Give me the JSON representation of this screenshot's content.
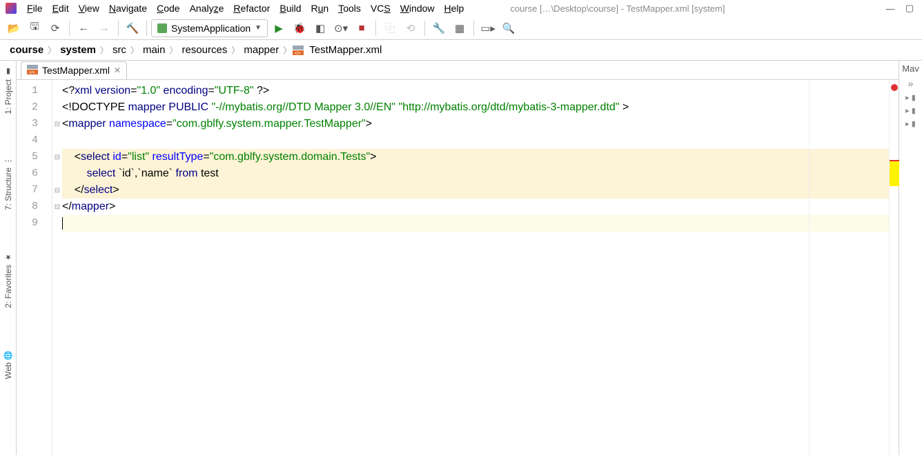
{
  "window": {
    "title": "course […\\Desktop\\course] - TestMapper.xml [system]"
  },
  "menu": {
    "file": "File",
    "edit": "Edit",
    "view": "View",
    "navigate": "Navigate",
    "code": "Code",
    "analyze": "Analyze",
    "refactor": "Refactor",
    "build": "Build",
    "run": "Run",
    "tools": "Tools",
    "vcs": "VCS",
    "window": "Window",
    "help": "Help"
  },
  "runconfig": {
    "label": "SystemApplication"
  },
  "breadcrumb": {
    "items": [
      "course",
      "system",
      "src",
      "main",
      "resources",
      "mapper",
      "TestMapper.xml"
    ]
  },
  "left_rail": {
    "project": "1: Project",
    "structure": "7: Structure",
    "favorites": "2: Favorites",
    "web": "Web"
  },
  "right_rail": {
    "maven": "Mav"
  },
  "tab": {
    "label": "TestMapper.xml"
  },
  "gutter": {
    "numbers": [
      "1",
      "2",
      "3",
      "4",
      "5",
      "6",
      "7",
      "8",
      "9"
    ]
  },
  "code": {
    "l1": {
      "a": "<?",
      "b": "xml version",
      "c": "=",
      "d": "\"1.0\"",
      "e": " encoding",
      "f": "=",
      "g": "\"UTF-8\"",
      "h": " ?>"
    },
    "l2": {
      "a": "<!DOCTYPE ",
      "b": "mapper ",
      "c": "PUBLIC ",
      "d": "\"-//mybatis.org//DTD Mapper 3.0//EN\" \"http://mybatis.org/dtd/mybatis-3-mapper.dtd\"",
      "e": " >"
    },
    "l3": {
      "a": "<",
      "b": "mapper ",
      "c": "namespace",
      "d": "=",
      "e": "\"com.gblfy.system.mapper.TestMapper\"",
      "f": ">"
    },
    "l4": "",
    "l5": {
      "pad": "    ",
      "a": "<",
      "b": "select ",
      "c": "id",
      "d": "=",
      "e": "\"list\"",
      "f": " resultType",
      "g": "=",
      "h": "\"com.gblfy.system.domain.Tests\"",
      "i": ">"
    },
    "l6": {
      "pad": "        ",
      "a": "select ",
      "b": "`id`",
      "c": ",",
      "d": "`name`",
      "e": " from ",
      "f": "test"
    },
    "l7": {
      "pad": "    ",
      "a": "</",
      "b": "select",
      "c": ">"
    },
    "l8": {
      "a": "</",
      "b": "mapper",
      "c": ">"
    }
  },
  "colors": {
    "keyword": "#000080",
    "string": "#008000",
    "attr": "#0000ff"
  }
}
